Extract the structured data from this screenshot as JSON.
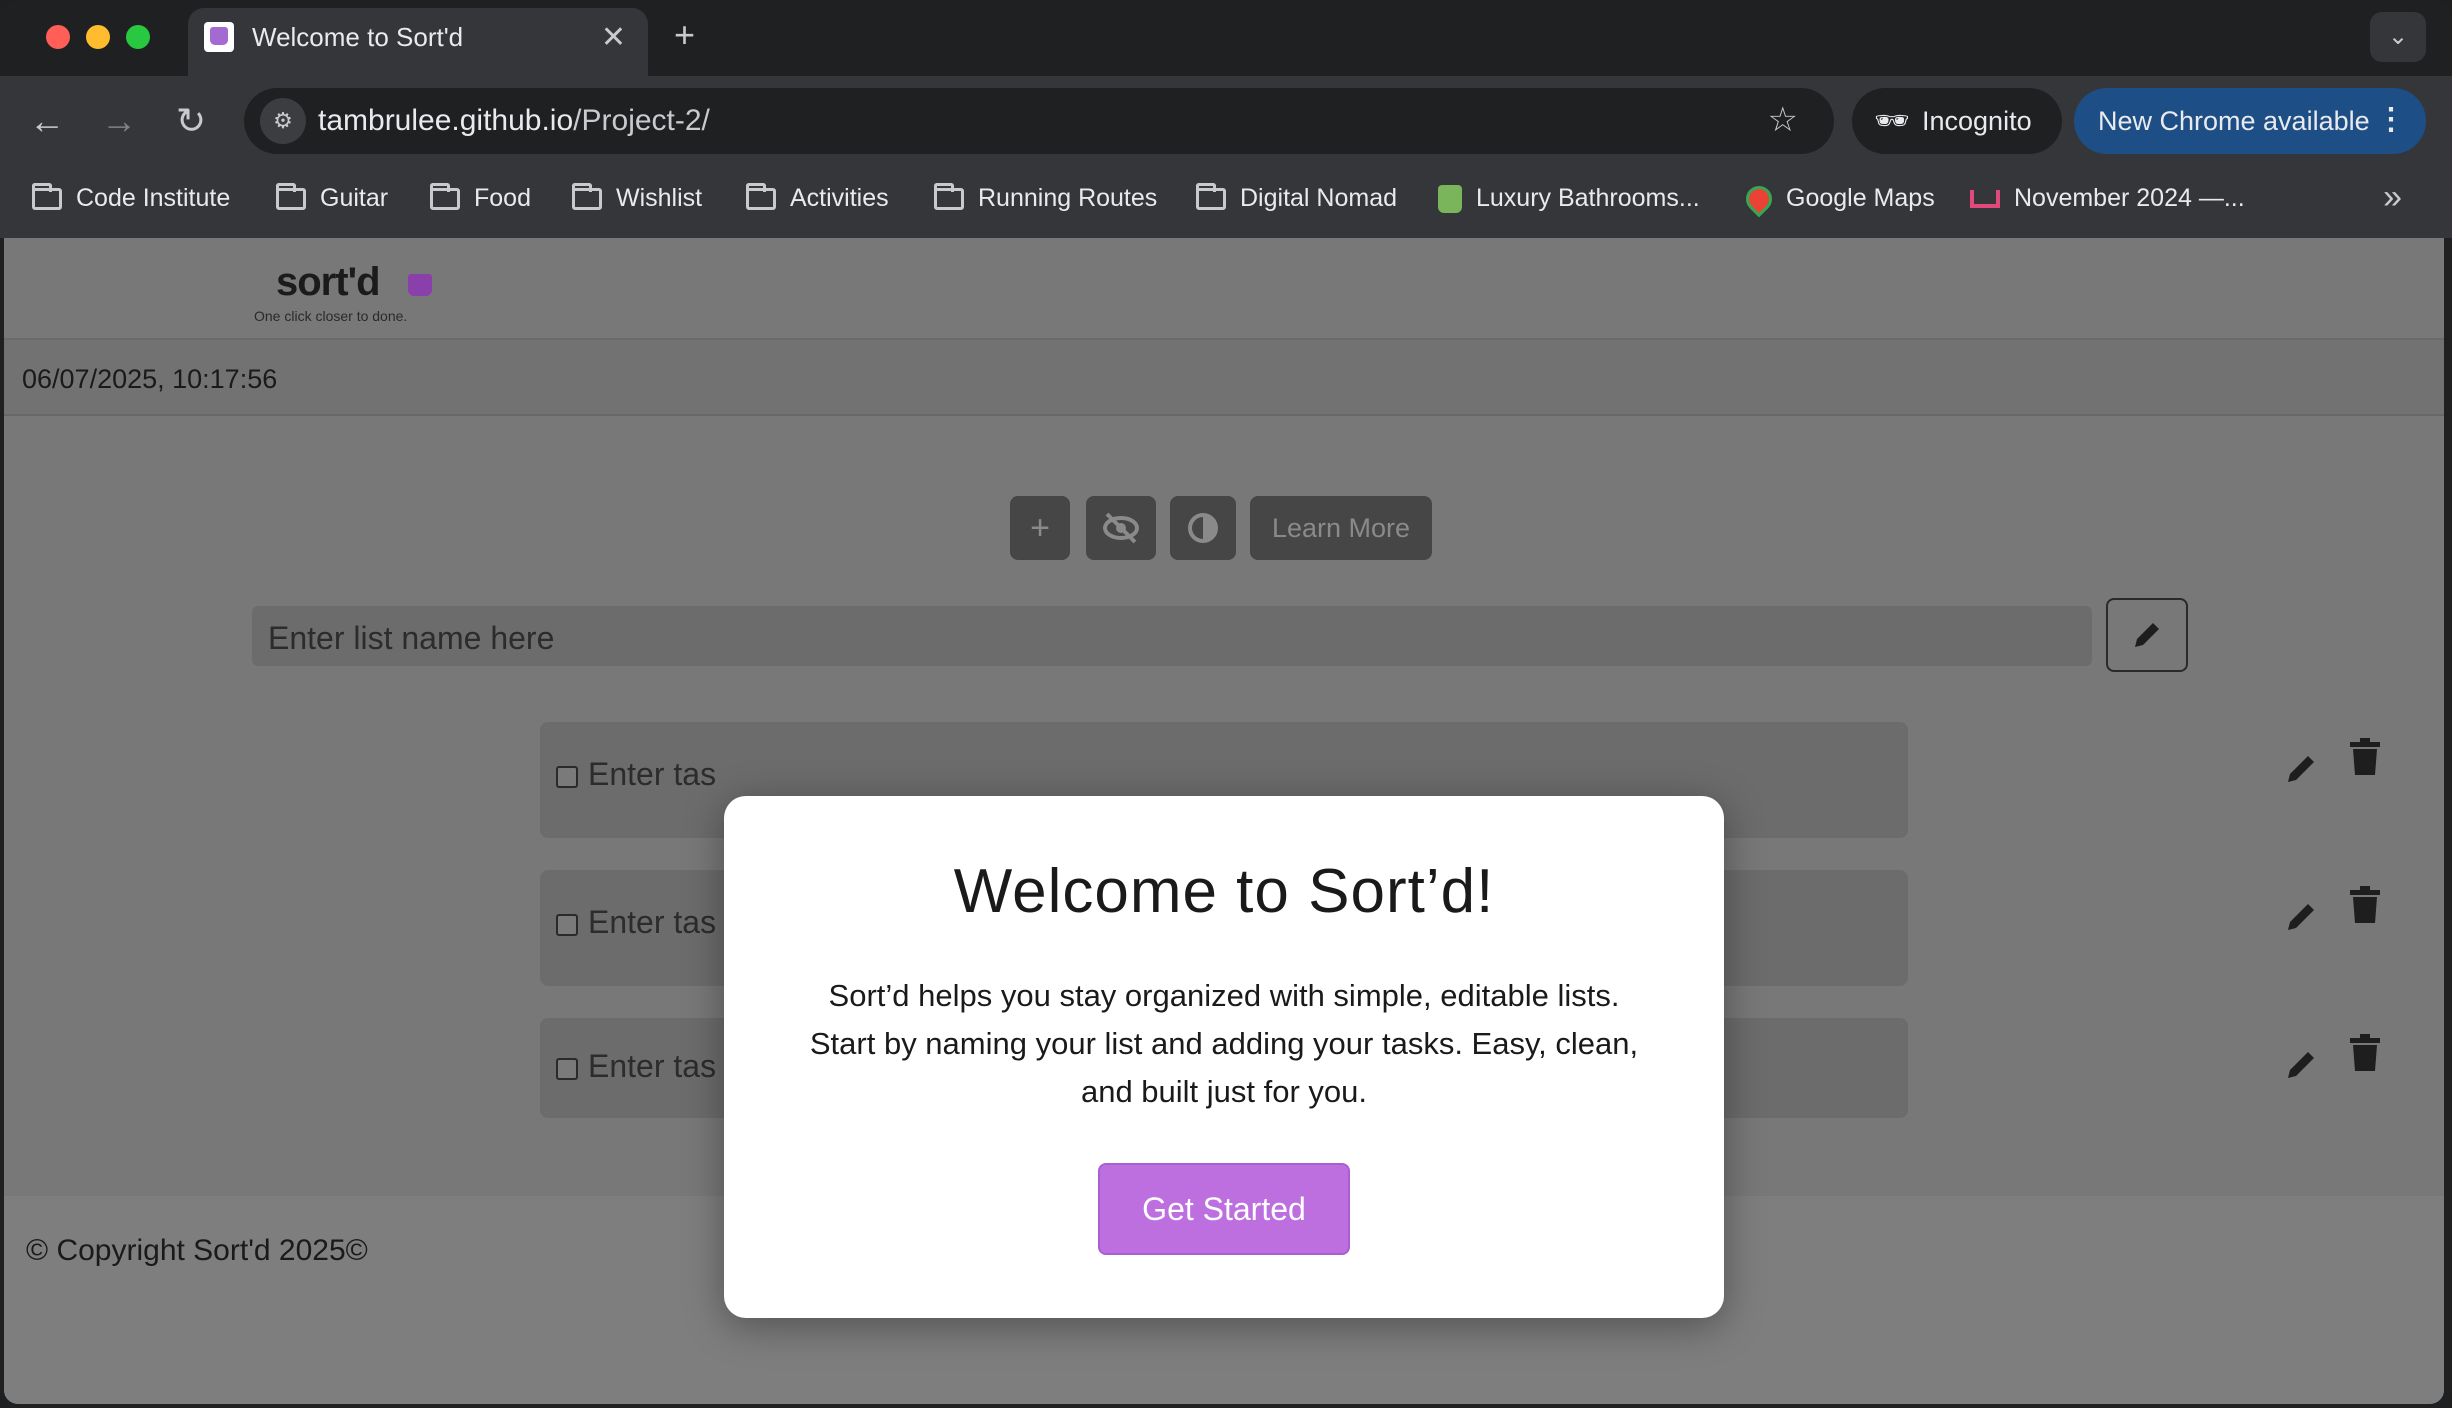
{
  "browser": {
    "tab": {
      "title": "Welcome to Sort'd",
      "close": "✕"
    },
    "new_tab": "+",
    "tab_menu": "⌄",
    "nav": {
      "back": "←",
      "forward": "→",
      "reload": "↻"
    },
    "address": {
      "host": "tambrulee.github.io",
      "path": "/Project-2/"
    },
    "incognito_label": "Incognito",
    "update_label": "New Chrome available",
    "update_menu": "⋮",
    "bookmarks": [
      {
        "label": "Code Institute",
        "icon": "folder-icon"
      },
      {
        "label": "Guitar",
        "icon": "folder-icon"
      },
      {
        "label": "Food",
        "icon": "folder-icon"
      },
      {
        "label": "Wishlist",
        "icon": "folder-icon"
      },
      {
        "label": "Activities",
        "icon": "folder-icon"
      },
      {
        "label": "Running Routes",
        "icon": "folder-icon"
      },
      {
        "label": "Digital Nomad",
        "icon": "folder-icon"
      },
      {
        "label": "Luxury Bathrooms...",
        "icon": "shopify-icon"
      },
      {
        "label": "Google Maps",
        "icon": "maps-pin-icon"
      },
      {
        "label": "November 2024 —...",
        "icon": "sofa-icon"
      }
    ],
    "bookmarks_overflow": "»"
  },
  "app": {
    "logo": {
      "word": "sort'd",
      "tagline": "One click closer to done."
    },
    "datetime": "06/07/2025, 10:17:56",
    "controls": {
      "add": "+",
      "hide": "hide-icon",
      "contrast": "contrast-icon",
      "learn_more": "Learn More"
    },
    "list_name_placeholder": "Enter list name here",
    "tasks": [
      {
        "placeholder": "Enter tas"
      },
      {
        "placeholder": "Enter tas"
      },
      {
        "placeholder": "Enter tas"
      }
    ],
    "footer": {
      "copyright": "© Copyright Sort'd 2025©"
    }
  },
  "modal": {
    "title": "Welcome to Sort’d!",
    "body": "Sort’d helps you stay organized with simple, editable lists. Start by naming your list and adding your tasks. Easy, clean, and built just for you.",
    "cta": "Get Started"
  },
  "colors": {
    "accent": "#bd6fe0",
    "brand_purple": "#8a40ab",
    "update_blue": "#1d4f86",
    "overlay_gray": "#787878"
  }
}
